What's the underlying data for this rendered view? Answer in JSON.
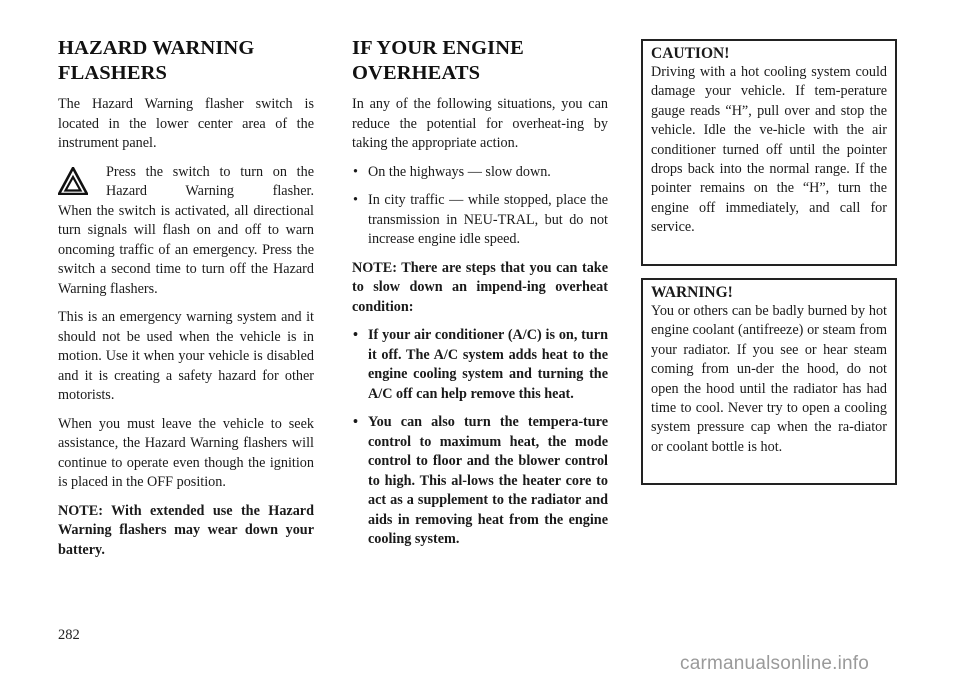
{
  "left_column": {
    "title": "HAZARD WARNING FLASHERS",
    "intro": "The Hazard Warning flasher switch is located in the lower center area of the instrument panel.",
    "hazard_icon": "hazard-warning-triangle-icon",
    "hazard_para": {
      "indented": "Press the switch to turn on the Hazard Warning flasher.",
      "rest": "When the switch is activated, all di­rectional turn signals will flash on and off to warn oncoming traffic of an emergency. Press the switch a second time to turn off the Hazard Warning flashers."
    },
    "para_emergency": "This is an emergency warning system and it should not be used when the vehicle is in motion. Use it when your vehicle is disabled and it is creating a safety hazard for other motorists.",
    "para_leave": "When you must leave the vehicle to seek assistance, the Hazard Warning flashers will continue to operate even though the ignition is placed in the OFF position.",
    "note": "NOTE: With extended use the Hazard Warning flashers may wear down your battery."
  },
  "middle_column": {
    "title": "IF YOUR ENGINE OVERHEATS",
    "intro": "In any of the following situations, you can reduce the potential for overheat-ing by taking the appropriate action.",
    "bullet_glyph": "•",
    "bullets": [
      "On the highways — slow down.",
      "In city traffic — while stopped, place the transmission in NEU-TRAL, but do not increase engine idle speed."
    ],
    "note": "NOTE: There are steps that you can take to slow down an impend-ing overheat condition:",
    "bold_bullets": [
      "If your air conditioner (A/C) is on, turn it off. The A/C system adds heat to the engine cooling system and turning the A/C off can help remove this heat.",
      "You can also turn the tempera-ture control to maximum heat, the mode control to floor and the blower control to high. This al-lows the heater core to act as a supplement to the radiator and aids in removing heat from the engine cooling system."
    ]
  },
  "right_column": {
    "caution": {
      "heading": "CAUTION!",
      "body": "Driving with a hot cooling system could damage your vehicle. If tem-perature gauge reads “H”, pull over and stop the vehicle. Idle the ve-hicle with the air conditioner turned off until the pointer drops back into the normal range. If the pointer remains on the “H”, turn the engine off immediately, and call for service."
    },
    "warning": {
      "heading": "WARNING!",
      "body": "You or others can be badly burned by hot engine coolant (antifreeze) or steam from your radiator. If you see or hear steam coming from un-der the hood, do not open the hood until the radiator has had time to cool. Never try to open a cooling system pressure cap when the ra-diator or coolant bottle is hot."
    }
  },
  "footer": {
    "page_number": "282",
    "watermark": "carmanualsonline.info"
  }
}
